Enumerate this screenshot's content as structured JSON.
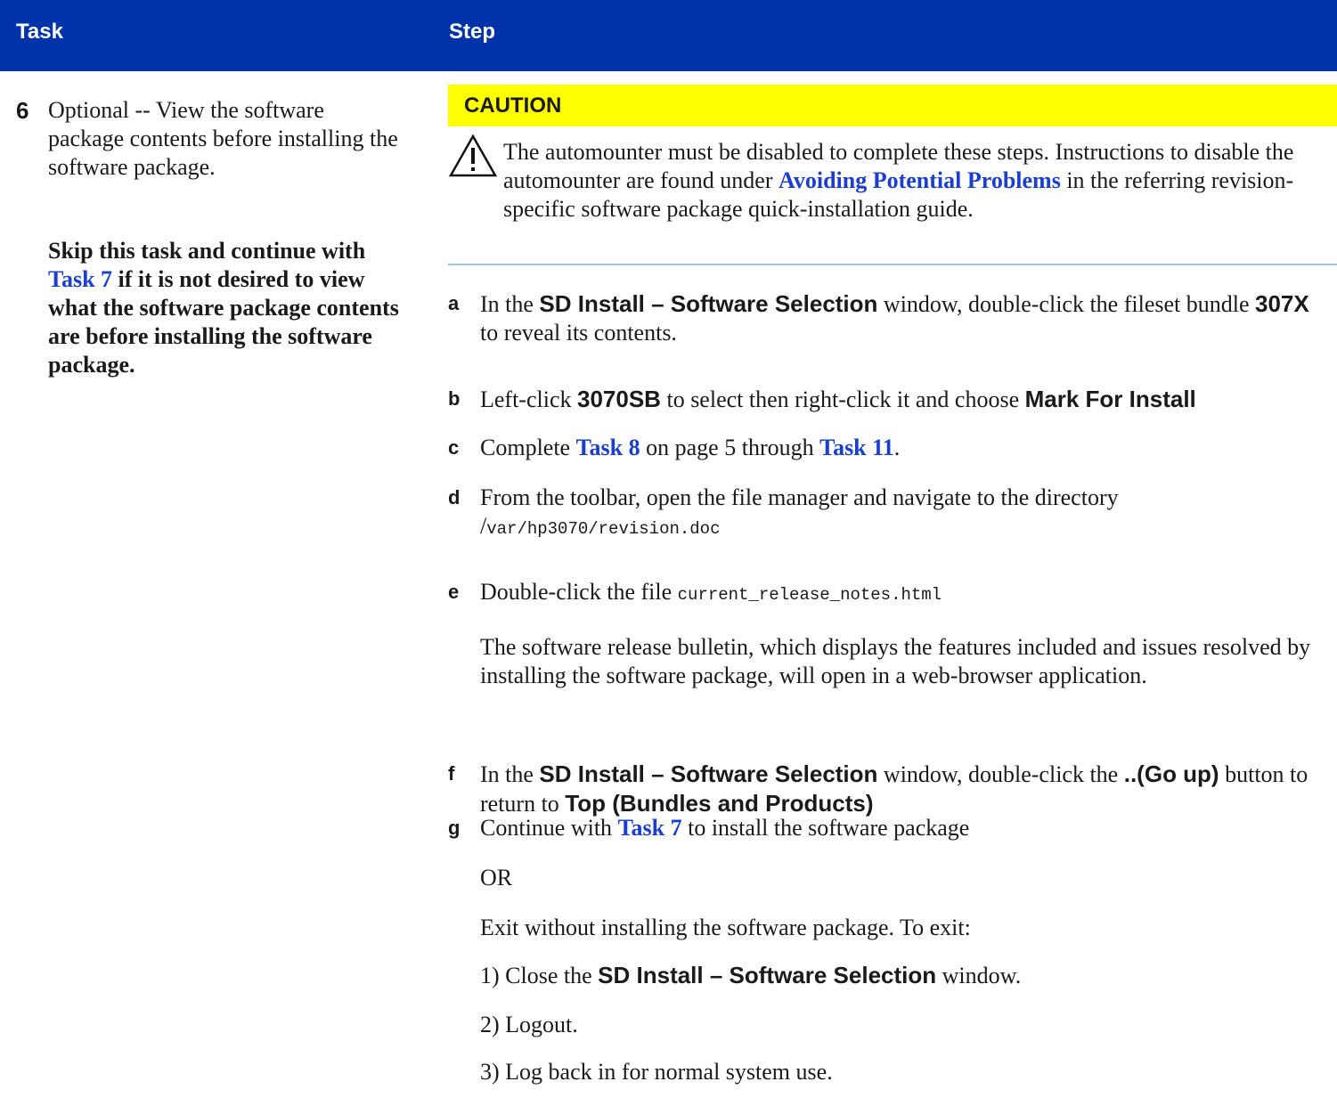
{
  "header": {
    "task": "Task",
    "step": "Step"
  },
  "task": {
    "number": "6",
    "text": "Optional -- View the software package contents before installing the software package.",
    "skip_before": "Skip this task and continue with ",
    "skip_link": "Task 7",
    "skip_after": " if it is not desired to view what the software package contents are before installing the software package."
  },
  "caution": {
    "label": "CAUTION",
    "text_before": "The automounter must be disabled to complete these steps. Instructions to disable the automounter are found under ",
    "link": "Avoiding Potential Problems",
    "text_after": " in the referring revision-specific software package quick-installation guide."
  },
  "steps": {
    "a": {
      "letter": "a",
      "t1": "In the ",
      "b1": "SD Install – Software Selection",
      "t2": " window, double-click the fileset bundle ",
      "b2": "307X",
      "t3": " to reveal its contents."
    },
    "b": {
      "letter": "b",
      "t1": "Left-click ",
      "b1": "3070SB",
      "t2": " to select then right-click it and choose ",
      "b2": "Mark For Install"
    },
    "c": {
      "letter": "c",
      "t1": "Complete ",
      "l1": "Task 8",
      "t2": " on page 5 through ",
      "l2": "Task 11",
      "t3": "."
    },
    "d": {
      "letter": "d",
      "t1": "From the toolbar, open the file manager and navigate to the directory ",
      "path_slash": "/",
      "path": "var/hp3070/revision.doc"
    },
    "e": {
      "letter": "e",
      "t1": "Double-click the file ",
      "file": "current_release_notes.html"
    },
    "e_note": "The software release bulletin, which displays the features included and issues resolved by installing the software package, will open in a web-browser application.",
    "f": {
      "letter": "f",
      "t1": "In the ",
      "b1": "SD Install – Software Selection",
      "t2": " window, double-click the ",
      "b2": "..(Go up)",
      "t3": " button to return to ",
      "b3": "Top (Bundles and Products)"
    },
    "g": {
      "letter": "g",
      "t1": "Continue with ",
      "l1": "Task 7",
      "t2": " to install the software package"
    },
    "or": "OR",
    "exit_intro": "Exit without installing the software package. To exit:",
    "exit_1_before": "1) Close the ",
    "exit_1_bold": "SD Install – Software Selection",
    "exit_1_after": " window.",
    "exit_2": "2) Logout.",
    "exit_3": "3) Log back in for normal system use."
  },
  "icons": {
    "caution": "warning-triangle-icon"
  },
  "colors": {
    "header_bg": "#0033aa",
    "caution_bg": "#ffff00",
    "link": "#1a3fd0"
  }
}
